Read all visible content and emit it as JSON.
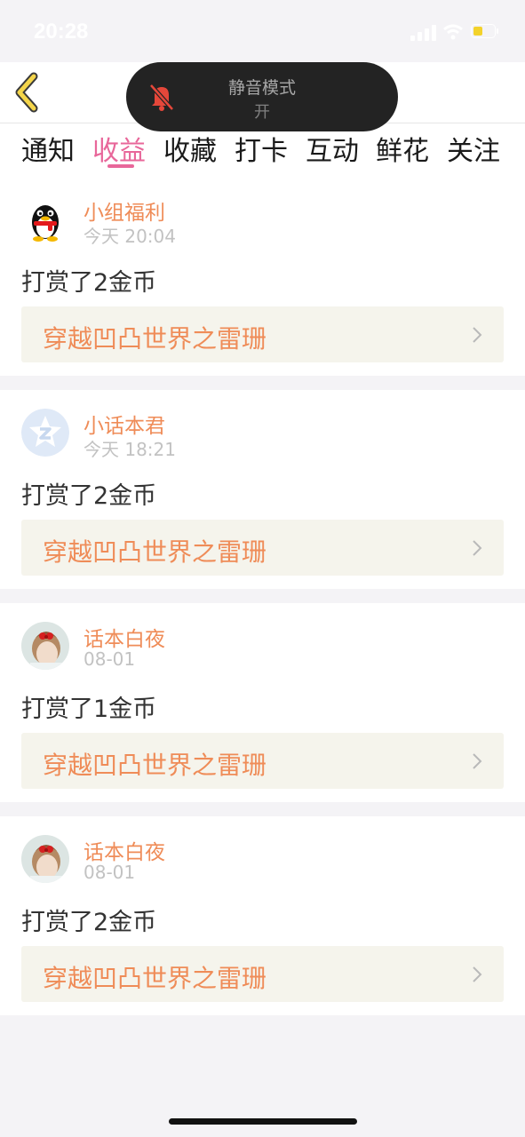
{
  "status_bar": {
    "time": "20:28"
  },
  "tabs": [
    {
      "label": "通知"
    },
    {
      "label": "收益"
    },
    {
      "label": "收藏"
    },
    {
      "label": "打卡"
    },
    {
      "label": "互动"
    },
    {
      "label": "鲜花"
    },
    {
      "label": "关注"
    }
  ],
  "active_tab": "收益",
  "toast": {
    "title": "静音模式",
    "subtitle": "开"
  },
  "feed": [
    {
      "username": "小组福利",
      "time": "今天 20:04",
      "reward": "打赏了2金币",
      "work_title": "穿越凹凸世界之雷珊",
      "avatar_icon": "qq-penguin-icon"
    },
    {
      "username": "小话本君",
      "time": "今天 18:21",
      "reward": "打赏了2金币",
      "work_title": "穿越凹凸世界之雷珊",
      "avatar_icon": "huaben-logo-icon"
    },
    {
      "username": "话本白夜",
      "time": "08-01",
      "reward": "打赏了1金币",
      "work_title": "穿越凹凸世界之雷珊",
      "avatar_icon": "user-photo"
    },
    {
      "username": "话本白夜",
      "time": "08-01",
      "reward": "打赏了2金币",
      "work_title": "穿越凹凸世界之雷珊",
      "avatar_icon": "user-photo"
    }
  ],
  "colors": {
    "accent_pink": "#e8679a",
    "orange": "#ef8c58",
    "back_arrow": "#f4d54a"
  }
}
